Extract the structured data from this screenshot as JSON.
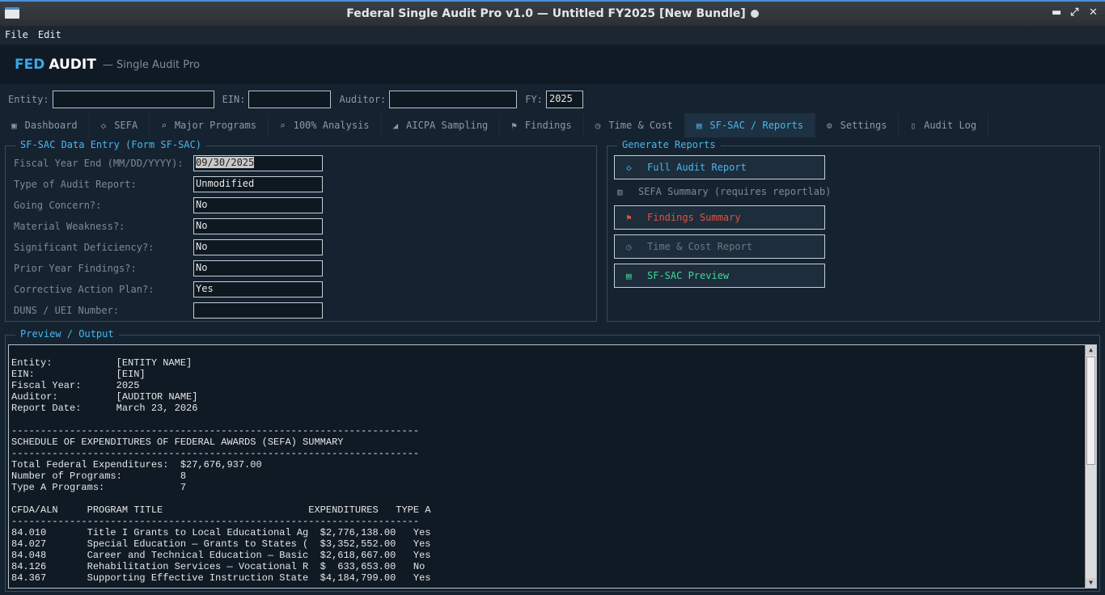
{
  "window": {
    "title": "Federal Single Audit Pro v1.0  —  Untitled FY2025  [New Bundle]",
    "controls": [
      "▬",
      "⤢",
      "✕"
    ]
  },
  "menu": {
    "items": [
      "File",
      "Edit"
    ]
  },
  "brand": {
    "fed": "FED",
    "audit": "AUDIT",
    "subtitle": "— Single Audit Pro"
  },
  "entitybar": {
    "entity_label": "Entity:",
    "entity_value": "",
    "ein_label": "EIN:",
    "ein_value": "",
    "auditor_label": "Auditor:",
    "auditor_value": "",
    "fy_label": "FY:",
    "fy_value": "2025"
  },
  "tabs": [
    {
      "icon": "▣",
      "label": "Dashboard"
    },
    {
      "icon": "◇",
      "label": "SEFA"
    },
    {
      "icon": "⌕",
      "label": "Major Programs"
    },
    {
      "icon": "⌕",
      "label": "100% Analysis"
    },
    {
      "icon": "◢",
      "label": "AICPA Sampling"
    },
    {
      "icon": "⚑",
      "label": "Findings"
    },
    {
      "icon": "◷",
      "label": "Time & Cost"
    },
    {
      "icon": "▤",
      "label": "SF-SAC / Reports"
    },
    {
      "icon": "⚙",
      "label": "Settings"
    },
    {
      "icon": "▯",
      "label": "Audit Log"
    }
  ],
  "active_tab": "SF-SAC / Reports",
  "sfsac": {
    "legend": "SF-SAC Data Entry (Form SF-SAC)",
    "fields": [
      {
        "label": "Fiscal Year End (MM/DD/YYYY):",
        "value": "09/30/2025"
      },
      {
        "label": "Type of Audit Report:",
        "value": "Unmodified"
      },
      {
        "label": "Going Concern?:",
        "value": "No"
      },
      {
        "label": "Material Weakness?:",
        "value": "No"
      },
      {
        "label": "Significant Deficiency?:",
        "value": "No"
      },
      {
        "label": "Prior Year Findings?:",
        "value": "No"
      },
      {
        "label": "Corrective Action Plan?:",
        "value": "Yes"
      },
      {
        "label": "DUNS / UEI Number:",
        "value": ""
      }
    ]
  },
  "reports": {
    "legend": "Generate Reports",
    "full_audit": "Full Audit Report",
    "sefa_summary": "SEFA Summary (requires reportlab)",
    "findings_summary": "Findings Summary",
    "time_cost": "Time & Cost Report",
    "sfsac_preview": "SF-SAC Preview"
  },
  "colors": {
    "accent": "#49b6ef",
    "findings": "#e0533f",
    "preview": "#3fd69a",
    "disabled": "#6c7884"
  },
  "output": {
    "legend": "Preview / Output",
    "text": "Entity:           [ENTITY NAME]\nEIN:              [EIN]\nFiscal Year:      2025\nAuditor:          [AUDITOR NAME]\nReport Date:      March 23, 2026\n\n----------------------------------------------------------------------\nSCHEDULE OF EXPENDITURES OF FEDERAL AWARDS (SEFA) SUMMARY\n----------------------------------------------------------------------\nTotal Federal Expenditures:  $27,676,937.00\nNumber of Programs:          8\nType A Programs:             7\n\nCFDA/ALN     PROGRAM TITLE                         EXPENDITURES   TYPE A\n----------------------------------------------------------------------\n84.010       Title I Grants to Local Educational Ag  $2,776,138.00   Yes\n84.027       Special Education — Grants to States (  $3,352,552.00   Yes\n84.048       Career and Technical Education — Basic  $2,618,667.00   Yes\n84.126       Rehabilitation Services — Vocational R  $  633,653.00   No\n84.367       Supporting Effective Instruction State  $4,184,799.00   Yes"
  }
}
